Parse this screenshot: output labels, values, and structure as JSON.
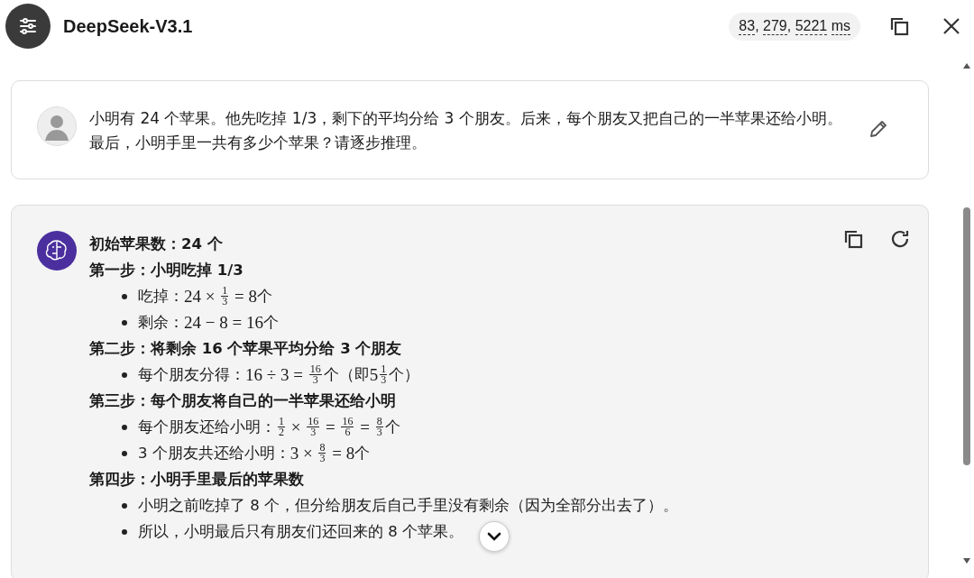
{
  "header": {
    "title": "DeepSeek-V3.1",
    "timings": [
      "83",
      "279",
      "5221"
    ],
    "separator": ", ",
    "unit": "ms"
  },
  "user_message": {
    "text": "小明有 24 个苹果。他先吃掉 1/3，剩下的平均分给 3 个朋友。后来，每个朋友又把自己的一半苹果还给小明。最后，小明手里一共有多少个苹果？请逐步推理。"
  },
  "answer": {
    "blocks": [
      {
        "kind": "heading",
        "parts": [
          {
            "kind": "text",
            "text": "初始苹果数：24 个"
          }
        ]
      },
      {
        "kind": "heading",
        "parts": [
          {
            "kind": "text",
            "text": "第一步：小明吃掉 1/3"
          }
        ]
      },
      {
        "kind": "bullet",
        "parts": [
          {
            "kind": "text",
            "text": "吃掉："
          },
          {
            "kind": "math",
            "text": "24 × "
          },
          {
            "kind": "frac",
            "num": "1",
            "den": "3"
          },
          {
            "kind": "math",
            "text": " = 8"
          },
          {
            "kind": "text",
            "text": " 个"
          }
        ]
      },
      {
        "kind": "bullet",
        "parts": [
          {
            "kind": "text",
            "text": "剩余："
          },
          {
            "kind": "math",
            "text": "24 − 8 = 16"
          },
          {
            "kind": "text",
            "text": " 个"
          }
        ]
      },
      {
        "kind": "heading",
        "parts": [
          {
            "kind": "text",
            "text": "第二步：将剩余 16 个苹果平均分给 3 个朋友"
          }
        ]
      },
      {
        "kind": "bullet",
        "parts": [
          {
            "kind": "text",
            "text": "每个朋友分得："
          },
          {
            "kind": "math",
            "text": "16 ÷ 3 = "
          },
          {
            "kind": "frac",
            "num": "16",
            "den": "3"
          },
          {
            "kind": "text",
            "text": " 个（即 "
          },
          {
            "kind": "math",
            "text": "5"
          },
          {
            "kind": "frac",
            "num": "1",
            "den": "3"
          },
          {
            "kind": "text",
            "text": " 个）"
          }
        ]
      },
      {
        "kind": "heading",
        "parts": [
          {
            "kind": "text",
            "text": "第三步：每个朋友将自己的一半苹果还给小明"
          }
        ]
      },
      {
        "kind": "bullet",
        "parts": [
          {
            "kind": "text",
            "text": "每个朋友还给小明："
          },
          {
            "kind": "frac",
            "num": "1",
            "den": "2"
          },
          {
            "kind": "math",
            "text": " × "
          },
          {
            "kind": "frac",
            "num": "16",
            "den": "3"
          },
          {
            "kind": "math",
            "text": " = "
          },
          {
            "kind": "frac",
            "num": "16",
            "den": "6"
          },
          {
            "kind": "math",
            "text": " = "
          },
          {
            "kind": "frac",
            "num": "8",
            "den": "3"
          },
          {
            "kind": "text",
            "text": " 个"
          }
        ]
      },
      {
        "kind": "bullet",
        "parts": [
          {
            "kind": "text",
            "text": "3 个朋友共还给小明："
          },
          {
            "kind": "math",
            "text": "3 × "
          },
          {
            "kind": "frac",
            "num": "8",
            "den": "3"
          },
          {
            "kind": "math",
            "text": " = 8"
          },
          {
            "kind": "text",
            "text": " 个"
          }
        ]
      },
      {
        "kind": "heading",
        "parts": [
          {
            "kind": "text",
            "text": "第四步：小明手里最后的苹果数"
          }
        ]
      },
      {
        "kind": "bullet",
        "parts": [
          {
            "kind": "text",
            "text": "小明之前吃掉了 8 个，但分给朋友后自己手里没有剩余（因为全部分出去了）。"
          }
        ]
      },
      {
        "kind": "bullet",
        "parts": [
          {
            "kind": "text",
            "text": "所以，小明最后只有朋友们还回来的 8 个苹果。"
          }
        ]
      }
    ]
  }
}
